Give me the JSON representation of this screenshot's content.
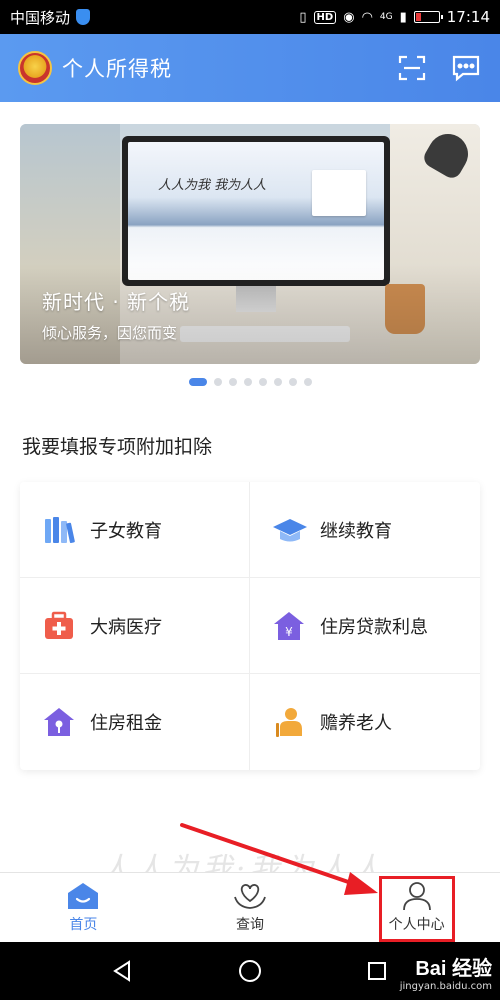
{
  "status_bar": {
    "carrier": "中国移动",
    "network": "4G",
    "time": "17:14"
  },
  "header": {
    "title": "个人所得税",
    "icons": [
      "scan-icon",
      "message-icon"
    ]
  },
  "banner": {
    "title": "新时代 · 新个税",
    "subtitle": "倾心服务，因您而变",
    "screen_text": "人人为我 我为人人",
    "slide_count": 8,
    "active_slide": 1
  },
  "section": {
    "title": "我要填报专项附加扣除"
  },
  "deductions": [
    {
      "label": "子女教育",
      "icon": "books-icon",
      "color": "#4a86e8"
    },
    {
      "label": "继续教育",
      "icon": "graduation-cap-icon",
      "color": "#4a86e8"
    },
    {
      "label": "大病医疗",
      "icon": "medical-kit-icon",
      "color": "#ef5d4b"
    },
    {
      "label": "住房贷款利息",
      "icon": "house-yuan-icon",
      "color": "#7b5fe0"
    },
    {
      "label": "住房租金",
      "icon": "house-key-icon",
      "color": "#7b5fe0"
    },
    {
      "label": "赡养老人",
      "icon": "elder-icon",
      "color": "#f2a93b"
    }
  ],
  "watermark_text": "人人为我·我为人人",
  "tabbar": {
    "tabs": [
      {
        "label": "首页",
        "icon": "home-icon",
        "active": true
      },
      {
        "label": "查询",
        "icon": "heart-hands-icon",
        "active": false
      },
      {
        "label": "个人中心",
        "icon": "person-icon",
        "active": false
      }
    ]
  },
  "navbar": {
    "buttons": [
      "back-icon",
      "home-circle-icon",
      "recents-icon"
    ]
  },
  "site_watermark": {
    "brand": "Bai 经验",
    "url": "jingyan.baidu.com"
  },
  "colors": {
    "accent": "#4a86e8",
    "highlight": "#e81e25"
  }
}
